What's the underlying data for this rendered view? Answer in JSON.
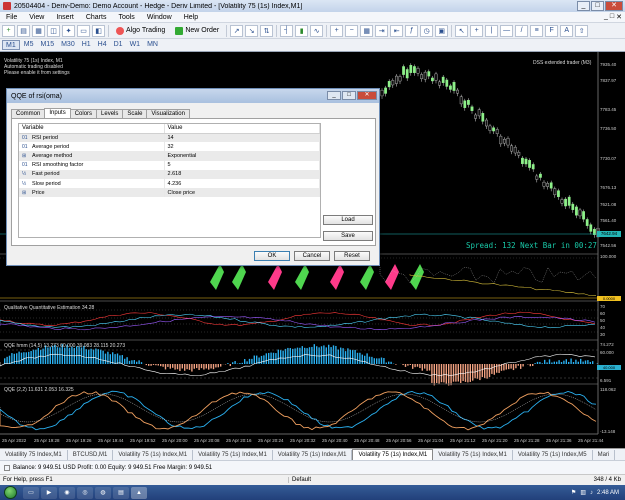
{
  "window": {
    "title": "20504404 - Deriv-Demo: Demo Account - Hedge - Deriv Limited - [Volatility 75 (1s) Index,M1]",
    "controls": [
      "_",
      "□",
      "✕"
    ]
  },
  "menu": {
    "items": [
      "File",
      "View",
      "Insert",
      "Charts",
      "Tools",
      "Window",
      "Help"
    ],
    "mdi_controls": [
      "_",
      "□",
      "✕"
    ]
  },
  "toolbar": {
    "algo_trading_label": "Algo Trading",
    "new_order_label": "New Order"
  },
  "timeframes": {
    "items": [
      "M1",
      "M5",
      "M15",
      "M30",
      "H1",
      "H4",
      "D1",
      "W1",
      "MN"
    ],
    "active": "M1"
  },
  "chart": {
    "info_lines": [
      "Volatility 75 (1s) Index, M1",
      "Automatic trading disabled",
      "Please enable it from settings"
    ],
    "indicator_tag": "DSS extended trader (M3)",
    "spread_text": "Spread: 132 Next Bar in 00:27",
    "current_price": "7642.94",
    "price_labels": [
      "7935.40",
      "7837.97",
      "7783.45",
      "7736.50",
      "7730.07",
      "7676.13",
      "7621.08",
      "7561.40",
      "7542.56"
    ],
    "subwindow_labels": [
      "Qualitative Quantitative Estimation 34.28",
      "QQE hmm (14,5) 13.273 60.000 39.083 28.115 20.273",
      "QQE (2,2) 11.631 2.053 16.325"
    ],
    "subwindow_levels": [
      "100.000",
      "0.0000",
      "70",
      "60",
      "50",
      "40",
      "30",
      "74.272",
      "60.000",
      "40.000",
      "6.591",
      "118.062",
      "-13.148"
    ],
    "time_labels": [
      "25 Apr 2022",
      "25 Apr 19:28",
      "25 Apr 19:26",
      "25 Apr 19:44",
      "25 Apr 19:52",
      "25 Apr 20:00",
      "25 Apr 20:08",
      "25 Apr 20:16",
      "25 Apr 20:24",
      "25 Apr 20:32",
      "25 Apr 20:40",
      "25 Apr 20:48",
      "25 Apr 20:56",
      "25 Apr 21:04",
      "25 Apr 21:12",
      "25 Apr 21:20",
      "25 Apr 21:28",
      "25 Apr 21:36",
      "25 Apr 21:44"
    ]
  },
  "dialog": {
    "title": "QQE of rsi(oma)",
    "tabs": [
      "Common",
      "Inputs",
      "Colors",
      "Levels",
      "Scale",
      "Visualization"
    ],
    "active_tab": "Inputs",
    "columns": [
      "Variable",
      "Value"
    ],
    "rows": [
      {
        "icon": "01",
        "variable": "RSI period",
        "value": "14"
      },
      {
        "icon": "01",
        "variable": "Average period",
        "value": "32"
      },
      {
        "icon": "⊞",
        "variable": "Average method",
        "value": "Exponential"
      },
      {
        "icon": "01",
        "variable": "RSI smoothing factor",
        "value": "5"
      },
      {
        "icon": "½",
        "variable": "Fast period",
        "value": "2.618"
      },
      {
        "icon": "½",
        "variable": "Slow period",
        "value": "4.236"
      },
      {
        "icon": "⊞",
        "variable": "Price",
        "value": "Close price"
      }
    ],
    "load_label": "Load",
    "save_label": "Save",
    "ok_label": "OK",
    "cancel_label": "Cancel",
    "reset_label": "Reset"
  },
  "chart_tabs": {
    "items": [
      "Volatility 75 Index,M1",
      "BTCUSD,M1",
      "Volatility 75 (1s) Index,M1",
      "Volatility 75 (1s) Index,M1",
      "Volatility 75 (1s) Index,M1",
      "Volatility 75 (1s) Index,M1",
      "Volatility 75 (1s) Index,M1",
      "Volatility 75 (1s) Index,M5",
      "Mari"
    ],
    "active_index": 5
  },
  "balance": {
    "text": "Balance: 9 949.51 USD  Profit: 0.00  Equity: 9 949.51  Free Margin: 9 949.51"
  },
  "status": {
    "help": "For Help, press F1",
    "profile": "Default",
    "traffic": "348 / 4 Kb"
  },
  "taskbar": {
    "time": "2:48 AM"
  }
}
